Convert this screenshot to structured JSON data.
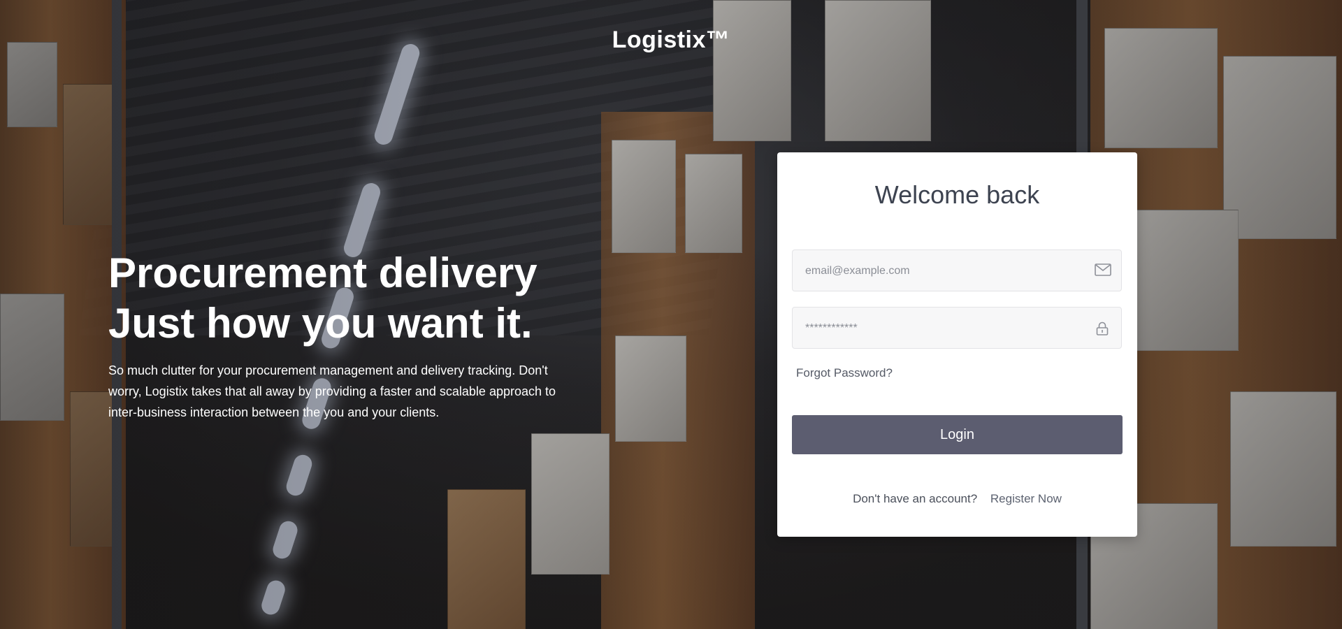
{
  "brand": {
    "name": "Logistix™"
  },
  "hero": {
    "headline_line1": "Procurement delivery",
    "headline_line2": "Just how you want it.",
    "description": "So much clutter for your procurement management and delivery tracking. Don't worry, Logistix takes that all away by providing a faster and scalable approach to inter-business interaction between the you and your clients."
  },
  "login_card": {
    "title": "Welcome back",
    "email_placeholder": "email@example.com",
    "password_placeholder": "************",
    "email_icon": "mail-icon",
    "password_icon": "lock-icon",
    "forgot_password": "Forgot Password?",
    "login_button": "Login",
    "register_prompt": "Don't have an account?",
    "register_link": "Register Now"
  },
  "colors": {
    "button": "#5c5d70",
    "card_background": "#ffffff",
    "title_text": "#3d4350"
  }
}
